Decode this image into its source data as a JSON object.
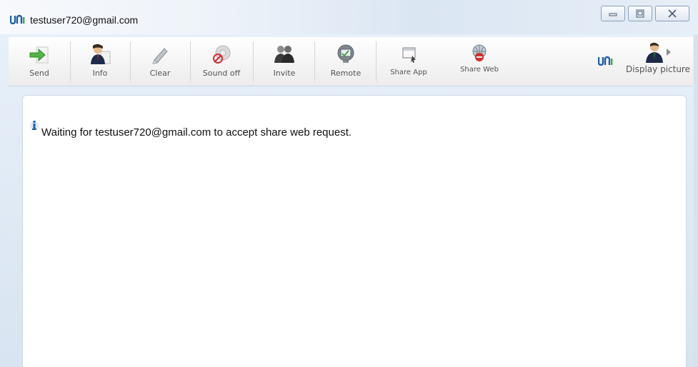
{
  "window": {
    "title": "testuser720@gmail.com",
    "controls": [
      "minimize",
      "maximize",
      "close"
    ]
  },
  "toolbar": {
    "items": [
      {
        "label": "Send",
        "icon": "send-icon"
      },
      {
        "label": "Info",
        "icon": "info-person-icon"
      },
      {
        "label": "Clear",
        "icon": "eraser-icon"
      },
      {
        "label": "Sound off",
        "icon": "sound-off-icon"
      },
      {
        "label": "Invite",
        "icon": "invite-people-icon"
      },
      {
        "label": "Remote",
        "icon": "remote-monitor-icon"
      },
      {
        "label": "Share App",
        "icon": "share-app-icon"
      },
      {
        "label": "Share Web",
        "icon": "share-web-icon"
      }
    ],
    "display_picture_label": "Display picture"
  },
  "chat": {
    "message": "Waiting for testuser720@gmail.com to accept share web request."
  },
  "colors": {
    "brand": "#1f5fa8",
    "brand_accent": "#3db04a"
  }
}
